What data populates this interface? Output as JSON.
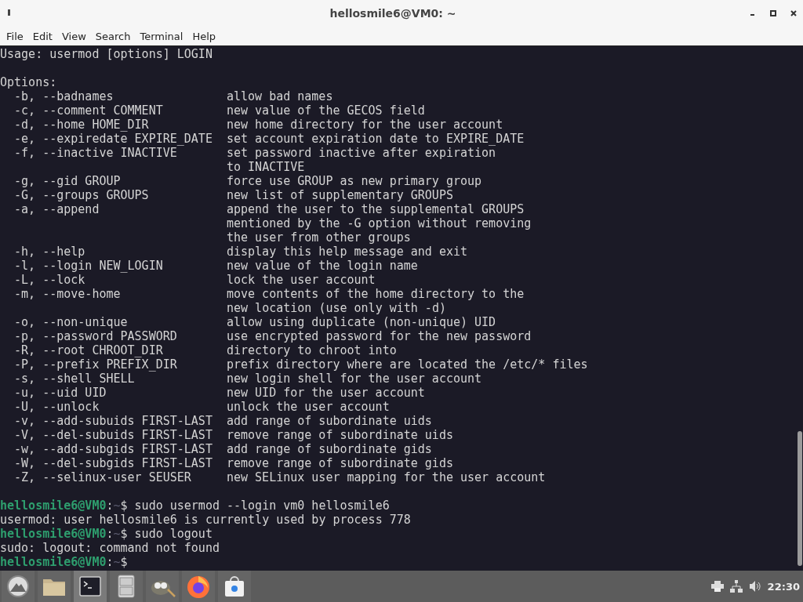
{
  "window": {
    "title": "hellosmile6@VM0: ~"
  },
  "menu": [
    "File",
    "Edit",
    "View",
    "Search",
    "Terminal",
    "Help"
  ],
  "lines": [
    {
      "kind": "text",
      "text": "Usage: usermod [options] LOGIN"
    },
    {
      "kind": "blank"
    },
    {
      "kind": "text",
      "text": "Options:"
    },
    {
      "kind": "option",
      "flag": "-b, --badnames",
      "desc": "allow bad names"
    },
    {
      "kind": "option",
      "flag": "-c, --comment COMMENT",
      "desc": "new value of the GECOS field"
    },
    {
      "kind": "option",
      "flag": "-d, --home HOME_DIR",
      "desc": "new home directory for the user account"
    },
    {
      "kind": "option",
      "flag": "-e, --expiredate EXPIRE_DATE",
      "desc": "set account expiration date to EXPIRE_DATE"
    },
    {
      "kind": "option",
      "flag": "-f, --inactive INACTIVE",
      "desc": "set password inactive after expiration"
    },
    {
      "kind": "option",
      "desc": "to INACTIVE"
    },
    {
      "kind": "option",
      "flag": "-g, --gid GROUP",
      "desc": "force use GROUP as new primary group"
    },
    {
      "kind": "option",
      "flag": "-G, --groups GROUPS",
      "desc": "new list of supplementary GROUPS"
    },
    {
      "kind": "option",
      "flag": "-a, --append",
      "desc": "append the user to the supplemental GROUPS"
    },
    {
      "kind": "option",
      "desc": "mentioned by the -G option without removing"
    },
    {
      "kind": "option",
      "desc": "the user from other groups"
    },
    {
      "kind": "option",
      "flag": "-h, --help",
      "desc": "display this help message and exit"
    },
    {
      "kind": "option",
      "flag": "-l, --login NEW_LOGIN",
      "desc": "new value of the login name"
    },
    {
      "kind": "option",
      "flag": "-L, --lock",
      "desc": "lock the user account"
    },
    {
      "kind": "option",
      "flag": "-m, --move-home",
      "desc": "move contents of the home directory to the"
    },
    {
      "kind": "option",
      "desc": "new location (use only with -d)"
    },
    {
      "kind": "option",
      "flag": "-o, --non-unique",
      "desc": "allow using duplicate (non-unique) UID"
    },
    {
      "kind": "option",
      "flag": "-p, --password PASSWORD",
      "desc": "use encrypted password for the new password"
    },
    {
      "kind": "option",
      "flag": "-R, --root CHROOT_DIR",
      "desc": "directory to chroot into"
    },
    {
      "kind": "option",
      "flag": "-P, --prefix PREFIX_DIR",
      "desc": "prefix directory where are located the /etc/* files"
    },
    {
      "kind": "option",
      "flag": "-s, --shell SHELL",
      "desc": "new login shell for the user account"
    },
    {
      "kind": "option",
      "flag": "-u, --uid UID",
      "desc": "new UID for the user account"
    },
    {
      "kind": "option",
      "flag": "-U, --unlock",
      "desc": "unlock the user account"
    },
    {
      "kind": "option",
      "flag": "-v, --add-subuids FIRST-LAST",
      "desc": "add range of subordinate uids"
    },
    {
      "kind": "option",
      "flag": "-V, --del-subuids FIRST-LAST",
      "desc": "remove range of subordinate uids"
    },
    {
      "kind": "option",
      "flag": "-w, --add-subgids FIRST-LAST",
      "desc": "add range of subordinate gids"
    },
    {
      "kind": "option",
      "flag": "-W, --del-subgids FIRST-LAST",
      "desc": "remove range of subordinate gids"
    },
    {
      "kind": "option",
      "flag": "-Z, --selinux-user SEUSER",
      "desc": "new SELinux user mapping for the user account"
    },
    {
      "kind": "blank"
    },
    {
      "kind": "prompt",
      "host": "hellosmile6@VM0",
      "sep": ":",
      "path": "~",
      "sign": "$",
      "command": "sudo usermod --login vm0 hellosmile6"
    },
    {
      "kind": "text",
      "text": "usermod: user hellosmile6 is currently used by process 778"
    },
    {
      "kind": "prompt",
      "host": "hellosmile6@VM0",
      "sep": ":",
      "path": "~",
      "sign": "$",
      "command": "sudo logout"
    },
    {
      "kind": "text",
      "text": "sudo: logout: command not found"
    },
    {
      "kind": "prompt",
      "host": "hellosmile6@VM0",
      "sep": ":",
      "path": "~",
      "sign": "$"
    }
  ],
  "taskbar": [
    {
      "kind": "menu",
      "selected": false
    },
    {
      "kind": "folder",
      "selected": false
    },
    {
      "kind": "terminal",
      "selected": true
    },
    {
      "kind": "cabinet",
      "selected": false
    },
    {
      "kind": "gimp",
      "selected": false
    },
    {
      "kind": "firefox",
      "selected": false
    },
    {
      "kind": "store",
      "selected": false
    }
  ],
  "tray": {
    "clock": "22:30"
  }
}
